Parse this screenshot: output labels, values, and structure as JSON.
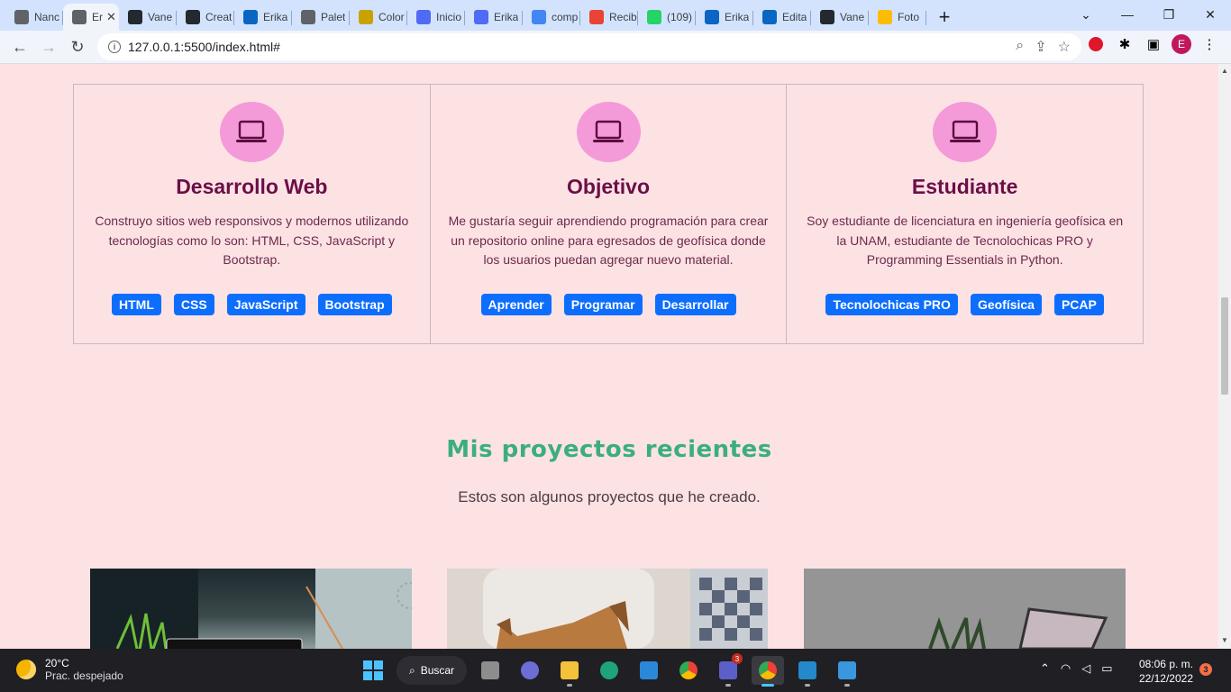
{
  "browser": {
    "tabs": [
      {
        "title": "Nanc",
        "icon": "settings-icon",
        "color": "#5f6368"
      },
      {
        "title": "Er",
        "icon": "globe-icon",
        "color": "#5f6368",
        "active": true
      },
      {
        "title": "Vane",
        "icon": "github-icon",
        "color": "#24292f"
      },
      {
        "title": "Creat",
        "icon": "github-icon",
        "color": "#24292f"
      },
      {
        "title": "Erika",
        "icon": "linkedin-icon",
        "color": "#0a66c2"
      },
      {
        "title": "Palet",
        "icon": "link-icon",
        "color": "#5f6368"
      },
      {
        "title": "Color",
        "icon": "shield-icon",
        "color": "#c8a200"
      },
      {
        "title": "Inicio",
        "icon": "canva-icon",
        "color": "#4f6af5"
      },
      {
        "title": "Erika",
        "icon": "canva-icon",
        "color": "#4f6af5"
      },
      {
        "title": "comp",
        "icon": "google-icon",
        "color": "#4285f4"
      },
      {
        "title": "Recib",
        "icon": "gmail-icon",
        "color": "#ea4335"
      },
      {
        "title": "(109)",
        "icon": "whatsapp-icon",
        "color": "#25d366"
      },
      {
        "title": "Erika",
        "icon": "linkedin-icon",
        "color": "#0a66c2"
      },
      {
        "title": "Edita",
        "icon": "linkedin-icon",
        "color": "#0a66c2"
      },
      {
        "title": "Vane",
        "icon": "github-icon",
        "color": "#24292f"
      },
      {
        "title": "Foto",
        "icon": "photos-icon",
        "color": "#fbbc04"
      }
    ],
    "close_glyph": "✕",
    "new_tab_glyph": "+",
    "url": "127.0.0.1:5500/index.html#",
    "profile_initial": "E"
  },
  "cards": [
    {
      "title": "Desarrollo Web",
      "text": "Construyo sitios web responsivos y modernos utilizando tecnologías como lo son: HTML, CSS, JavaScript y Bootstrap.",
      "badges": [
        "HTML",
        "CSS",
        "JavaScript",
        "Bootstrap"
      ]
    },
    {
      "title": "Objetivo",
      "text": "Me gustaría seguir aprendiendo programación para crear un repositorio online para egresados de geofísica donde los usuarios puedan agregar nuevo material.",
      "badges": [
        "Aprender",
        "Programar",
        "Desarrollar"
      ]
    },
    {
      "title": "Estudiante",
      "text": "Soy estudiante de licenciatura en ingeniería geofísica en la UNAM, estudiante de Tecnolochicas PRO y Programming Essentials in Python.",
      "badges": [
        "Tecnolochicas PRO",
        "Geofísica",
        "PCAP"
      ]
    }
  ],
  "projects_section": {
    "title": "Mis proyectos recientes",
    "subtitle": "Estos son algunos proyectos que he creado."
  },
  "taskbar": {
    "weather_temp": "20°C",
    "weather_desc": "Prac. despejado",
    "search_label": "Buscar",
    "teams_badge": "3",
    "time": "08:06 p. m.",
    "date": "22/12/2022",
    "notifications": "3"
  },
  "colors": {
    "page_bg": "#fde2e4",
    "heading": "#6b0f47",
    "badge": "#0d6efd",
    "icon_circle": "#f49ad8",
    "section_title": "#3cae7e"
  }
}
